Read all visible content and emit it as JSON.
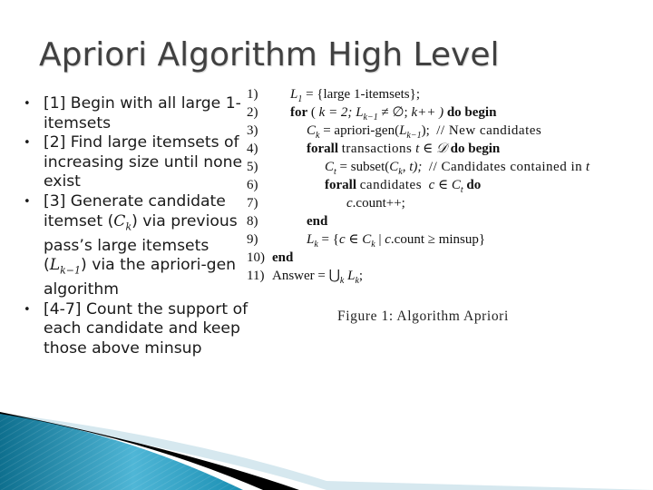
{
  "slide": {
    "title": "Apriori Algorithm High Level",
    "bullets": [
      {
        "bullet_icon": "bullet-dot",
        "segments": [
          {
            "t": "[1] Begin with all large 1-itemsets"
          }
        ]
      },
      {
        "bullet_icon": "bullet-dot",
        "segments": [
          {
            "t": "[2] Find large itemsets of increasing size until none exist"
          }
        ]
      },
      {
        "bullet_icon": "bullet-dot",
        "segments": [
          {
            "t": "[3] Generate candidate itemset ("
          },
          {
            "m": "C",
            "sub": "k"
          },
          {
            "t": ") via previous pass’s large itemsets ("
          },
          {
            "m": "L",
            "sub": "k−1"
          },
          {
            "t": ") via the apriori-gen algorithm"
          }
        ]
      },
      {
        "bullet_icon": "bullet-dot",
        "segments": [
          {
            "t": "[4-7] Count the support of each candidate and keep those above minsup"
          }
        ]
      }
    ]
  },
  "algorithm": {
    "lines": [
      {
        "num": "1)",
        "text": "L₁ = {large 1-itemsets};"
      },
      {
        "num": "2)",
        "text": "for ( k = 2; Lₖ₋₁ ≠ ∅; k++ ) do begin"
      },
      {
        "num": "3)",
        "text": "Cₖ = apriori-gen(Lₖ₋₁); // New candidates"
      },
      {
        "num": "4)",
        "text": "forall transactions t ∈ 𝒟 do begin"
      },
      {
        "num": "5)",
        "text": "Cₜ = subset(Cₖ, t); // Candidates contained in t"
      },
      {
        "num": "6)",
        "text": "forall candidates c ∈ Cₜ do"
      },
      {
        "num": "7)",
        "text": "c.count++;"
      },
      {
        "num": "8)",
        "text": "end"
      },
      {
        "num": "9)",
        "text": "Lₖ = {c ∈ Cₖ | c.count ≥ minsup}"
      },
      {
        "num": "10)",
        "text": "end"
      },
      {
        "num": "11)",
        "text": "Answer = ⋃ₖ Lₖ;"
      }
    ],
    "tokens": {
      "for": "for",
      "do_begin": "do begin",
      "do": "do",
      "forall": "forall",
      "end": "end",
      "k_eq_2": "k = 2;",
      "neq_empty": "≠ ∅;",
      "kpp": "k++ )",
      "L": "L",
      "C": "C",
      "k": "k",
      "t": "t",
      "c": "c",
      "km1": "k−1",
      "one": "1",
      "large1": "= {large 1-itemsets};",
      "apriori_gen": "= apriori-gen(",
      "close_semi": ");",
      "new_candidates": "// New candidates",
      "transactions": "transactions",
      "in_D": "∈ 𝒟",
      "subset": "= subset(",
      "subset_args": ", t);",
      "contained": "// Candidates contained in",
      "candidates": "candidates",
      "in": "∈",
      "count_pp": ".count++;",
      "set_open": "= {",
      "bar": "|",
      "count_ge": ".count ≥ minsup}",
      "answer": "Answer = ⋃",
      "semi": ";",
      "open_paren": "( "
    },
    "caption": "Figure 1: Algorithm Apriori"
  },
  "colors": {
    "title": "#404040",
    "text": "#1a1a1a",
    "accent_blue_dark": "#0e6f8e",
    "accent_blue_light": "#4fb6d6",
    "accent_pale": "#d6e8ef",
    "accent_black": "#000000"
  }
}
